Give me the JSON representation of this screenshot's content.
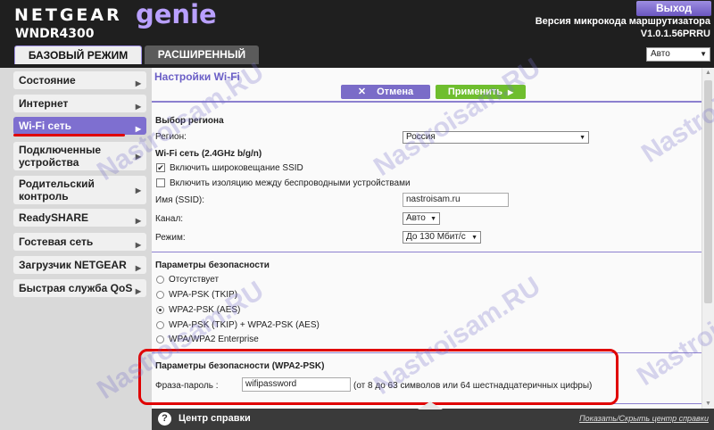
{
  "header": {
    "brand": "NETGEAR",
    "product": "genie",
    "model": "WNDR4300",
    "logout_label": "Выход",
    "firmware_label": "Версия микрокода маршрутизатора",
    "firmware_version": "V1.0.1.56PRRU",
    "tabs": [
      {
        "label": "БАЗОВЫЙ РЕЖИМ",
        "active": true
      },
      {
        "label": "РАСШИРЕННЫЙ",
        "active": false
      }
    ],
    "language": "Авто"
  },
  "sidebar": {
    "items": [
      {
        "label": "Состояние"
      },
      {
        "label": "Интернет"
      },
      {
        "label": "Wi-Fi сеть",
        "active": true
      },
      {
        "label": "Подключенные устройства"
      },
      {
        "label": "Родительский контроль"
      },
      {
        "label": "ReadySHARE"
      },
      {
        "label": "Гостевая сеть"
      },
      {
        "label": "Загрузчик NETGEAR"
      },
      {
        "label": "Быстрая служба QoS"
      }
    ]
  },
  "main": {
    "title": "Настройки Wi-Fi",
    "cancel_label": "Отмена",
    "apply_label": "Применить",
    "region_heading": "Выбор региона",
    "region_label": "Регион:",
    "region_value": "Россия",
    "wifi_heading": "Wi-Fi сеть (2.4GHz b/g/n)",
    "ssid_broadcast_label": "Включить широковещание SSID",
    "ssid_broadcast_checked": true,
    "isolation_label": "Включить изоляцию между беспроводными устройствами",
    "isolation_checked": false,
    "ssid_label": "Имя (SSID):",
    "ssid_value": "nastroisam.ru",
    "channel_label": "Канал:",
    "channel_value": "Авто",
    "mode_label": "Режим:",
    "mode_value": "До 130 Мбит/с",
    "security_heading": "Параметры безопасности",
    "security_options": [
      {
        "label": "Отсутствует",
        "selected": false
      },
      {
        "label": "WPA-PSK (TKIP)",
        "selected": false
      },
      {
        "label": "WPA2-PSK (AES)",
        "selected": true
      },
      {
        "label": "WPA-PSK (TKIP) + WPA2-PSK (AES)",
        "selected": false
      },
      {
        "label": "WPA/WPA2 Enterprise",
        "selected": false
      }
    ],
    "wpa2_heading": "Параметры безопасности (WPA2-PSK)",
    "passphrase_label": "Фраза-пароль :",
    "passphrase_value": "wifipassword",
    "passphrase_hint": "(от 8 до 63 символов или 64 шестнадцатеричных цифры)"
  },
  "footer": {
    "help_title": "Центр справки",
    "help_toggle": "Показать/Скрыть центр справки"
  },
  "watermark": "Nastroisam.RU",
  "colors": {
    "accent": "#7e6fd0",
    "apply": "#6fbe2e",
    "highlight": "#e00000"
  }
}
